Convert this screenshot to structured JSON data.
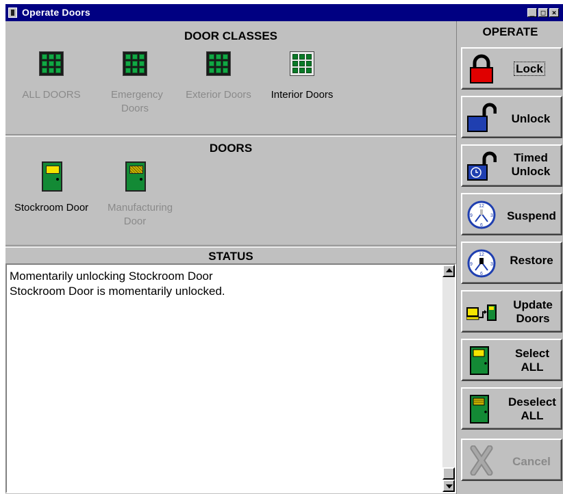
{
  "window": {
    "title": "Operate Doors",
    "controls": [
      "_",
      "□",
      "×"
    ]
  },
  "door_classes": {
    "title": "DOOR CLASSES",
    "items": [
      {
        "label": "ALL DOORS",
        "enabled": false,
        "icon": "door-class-grid-icon"
      },
      {
        "label": "Emergency Doors",
        "enabled": false,
        "icon": "door-class-grid-icon"
      },
      {
        "label": "Exterior Doors",
        "enabled": false,
        "icon": "door-class-grid-icon"
      },
      {
        "label": "Interior Doors",
        "enabled": true,
        "icon": "door-class-grid-icon"
      }
    ]
  },
  "doors": {
    "title": "DOORS",
    "items": [
      {
        "label": "Stockroom Door",
        "enabled": true,
        "icon": "door-icon"
      },
      {
        "label": "Manufacturing Door",
        "enabled": false,
        "icon": "door-icon"
      }
    ]
  },
  "status": {
    "title": "STATUS",
    "lines": [
      "Momentarily unlocking Stockroom Door",
      "Stockroom Door is momentarily unlocked."
    ]
  },
  "operate": {
    "title": "OPERATE",
    "buttons": [
      {
        "label": "Lock",
        "icon": "padlock-locked-icon",
        "color": "#e00000"
      },
      {
        "label": "Unlock",
        "icon": "padlock-unlocked-icon",
        "color": "#1f3fb0"
      },
      {
        "label_line1": "Timed",
        "label_line2": "Unlock",
        "icon": "timed-unlock-icon",
        "color": "#1f3fb0"
      },
      {
        "label": "Suspend",
        "icon": "clock-suspend-icon"
      },
      {
        "label": "Restore",
        "icon": "clock-restore-icon"
      },
      {
        "label_line1": "Update",
        "label_line2": "Doors",
        "icon": "update-doors-icon"
      },
      {
        "label_line1": "Select",
        "label_line2": "ALL",
        "icon": "door-select-icon"
      },
      {
        "label_line1": "Deselect",
        "label_line2": "ALL",
        "icon": "door-deselect-icon"
      },
      {
        "label": "Cancel",
        "icon": "cancel-x-icon",
        "enabled": false
      }
    ]
  },
  "colors": {
    "titlebar": "#000082",
    "panel": "#c0c0c0",
    "door_green": "#138a35",
    "door_window": "#f5e400"
  }
}
